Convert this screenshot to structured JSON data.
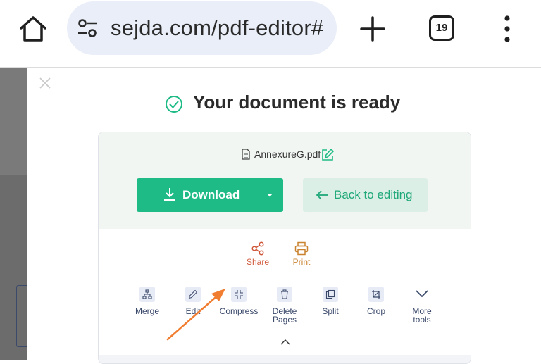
{
  "browser": {
    "url": "sejda.com/pdf-editor#",
    "tab_count": "19",
    "icons": [
      "home-icon",
      "page-info-icon",
      "plus-icon",
      "tab-switcher-icon",
      "more-vert-icon"
    ]
  },
  "dialog": {
    "title": "Your document is ready",
    "file_name": "AnnexureG.pdf",
    "download_label": "Download",
    "back_label": "Back to editing",
    "actions": [
      {
        "label": "Share",
        "color": "#d0583a"
      },
      {
        "label": "Print",
        "color": "#c9822d"
      }
    ],
    "tools": [
      {
        "label": "Merge"
      },
      {
        "label": "Edit"
      },
      {
        "label": "Compress"
      },
      {
        "label": "Delete\nPages"
      },
      {
        "label": "Split"
      },
      {
        "label": "Crop"
      },
      {
        "label": "More\ntools"
      }
    ]
  },
  "colors": {
    "accent_green": "#1fbb86",
    "back_button_bg": "#dcefe6",
    "annotation_arrow": "#f07d30"
  }
}
